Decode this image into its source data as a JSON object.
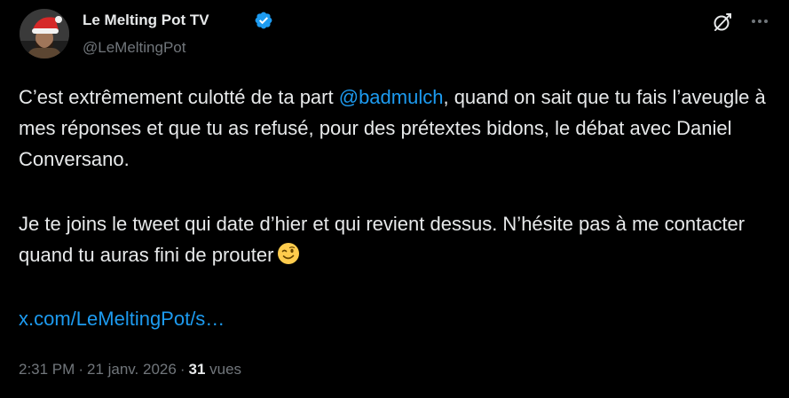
{
  "author": {
    "name": "Le Melting Pot TV",
    "handle": "@LeMeltingPot"
  },
  "tweet": {
    "para1_prefix": "C’est extrêmement culotté de ta part ",
    "para1_mention": "@badmulch",
    "para1_suffix": ", quand on sait que tu fais l’aveugle à mes réponses et que tu as refusé, pour des prétextes bidons, le débat avec Daniel Conversano.",
    "para2_text": "Je te joins le tweet qui date d’hier et qui revient dessus. N’hésite pas à me contacter quand tu auras fini de prouter",
    "emoji": "winking-face",
    "link": "x.com/LeMeltingPot/s…"
  },
  "meta": {
    "time": "2:31 PM",
    "separator": "·",
    "date": "21 janv. 2026",
    "views_count": "31",
    "views_label": "vues"
  },
  "icons": {
    "verified": "verified-badge-icon",
    "grok": "grok-icon",
    "more": "more-icon"
  },
  "colors": {
    "background": "#000000",
    "text": "#e7e9ea",
    "secondary": "#71767b",
    "accent": "#1d9bf0"
  }
}
